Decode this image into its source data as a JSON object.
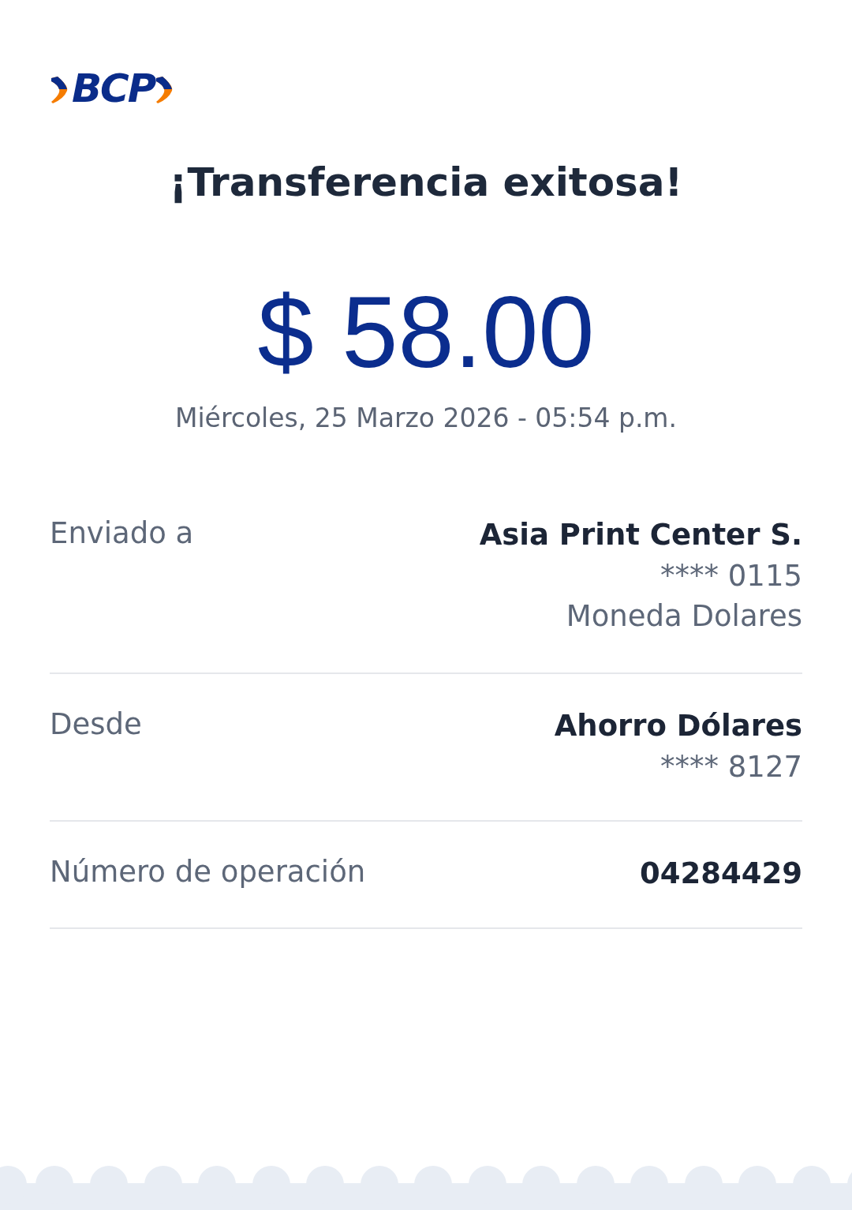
{
  "logo": {
    "text": "BCP"
  },
  "title": "¡Transferencia exitosa!",
  "amount": "$ 58.00",
  "datetime": "Miércoles, 25 Marzo 2026 - 05:54 p.m.",
  "details": [
    {
      "label": "Enviado a",
      "value": "Asia Print Center S.",
      "lines": [
        "**** 0115",
        "Moneda Dolares"
      ]
    },
    {
      "label": "Desde",
      "value": "Ahorro Dólares",
      "lines": [
        "**** 8127"
      ]
    },
    {
      "label": "Número de operación",
      "value": "04284429"
    }
  ]
}
